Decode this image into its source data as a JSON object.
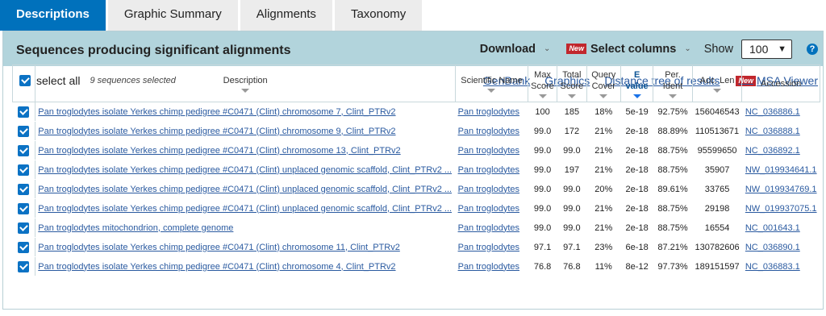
{
  "tabs": [
    {
      "label": "Descriptions",
      "active": true
    },
    {
      "label": "Graphic Summary",
      "active": false
    },
    {
      "label": "Alignments",
      "active": false
    },
    {
      "label": "Taxonomy",
      "active": false
    }
  ],
  "panel": {
    "title": "Sequences producing significant alignments",
    "download_label": "Download",
    "new_badge": "New",
    "select_columns_label": "Select columns",
    "show_label": "Show",
    "show_value": "100",
    "help_glyph": "?"
  },
  "toolbar": {
    "select_all_label": "select all",
    "selected_count": "9 sequences selected",
    "links": {
      "genbank": "GenBank",
      "graphics": "Graphics",
      "distance_tree": "Distance tree of results",
      "msa_viewer": "MSA Viewer"
    },
    "msa_badge": "New"
  },
  "table": {
    "headers": {
      "description": "Description",
      "scientific_name": "Scientific Name",
      "max_score": [
        "Max",
        "Score"
      ],
      "total_score": [
        "Total",
        "Score"
      ],
      "query_cover": [
        "Query",
        "Cover"
      ],
      "e_value": [
        "E",
        "value"
      ],
      "per_ident": [
        "Per.",
        "Ident"
      ],
      "acc_len": "Acc. Len",
      "accession": "Accession"
    },
    "rows": [
      {
        "checked": true,
        "description": "Pan troglodytes isolate Yerkes chimp pedigree #C0471 (Clint) chromosome 7, Clint_PTRv2",
        "scientific_name": "Pan troglodytes",
        "max_score": "100",
        "total_score": "185",
        "query_cover": "18%",
        "e_value": "5e-19",
        "per_ident": "92.75%",
        "acc_len": "156046543",
        "accession": "NC_036886.1"
      },
      {
        "checked": true,
        "description": "Pan troglodytes isolate Yerkes chimp pedigree #C0471 (Clint) chromosome 9, Clint_PTRv2",
        "scientific_name": "Pan troglodytes",
        "max_score": "99.0",
        "total_score": "172",
        "query_cover": "21%",
        "e_value": "2e-18",
        "per_ident": "88.89%",
        "acc_len": "110513671",
        "accession": "NC_036888.1"
      },
      {
        "checked": true,
        "description": "Pan troglodytes isolate Yerkes chimp pedigree #C0471 (Clint) chromosome 13, Clint_PTRv2",
        "scientific_name": "Pan troglodytes",
        "max_score": "99.0",
        "total_score": "99.0",
        "query_cover": "21%",
        "e_value": "2e-18",
        "per_ident": "88.75%",
        "acc_len": "95599650",
        "accession": "NC_036892.1"
      },
      {
        "checked": true,
        "description": "Pan troglodytes isolate Yerkes chimp pedigree #C0471 (Clint) unplaced genomic scaffold, Clint_PTRv2 ...",
        "scientific_name": "Pan troglodytes",
        "max_score": "99.0",
        "total_score": "197",
        "query_cover": "21%",
        "e_value": "2e-18",
        "per_ident": "88.75%",
        "acc_len": "35907",
        "accession": "NW_019934641.1"
      },
      {
        "checked": true,
        "description": "Pan troglodytes isolate Yerkes chimp pedigree #C0471 (Clint) unplaced genomic scaffold, Clint_PTRv2 ...",
        "scientific_name": "Pan troglodytes",
        "max_score": "99.0",
        "total_score": "99.0",
        "query_cover": "20%",
        "e_value": "2e-18",
        "per_ident": "89.61%",
        "acc_len": "33765",
        "accession": "NW_019934769.1"
      },
      {
        "checked": true,
        "description": "Pan troglodytes isolate Yerkes chimp pedigree #C0471 (Clint) unplaced genomic scaffold, Clint_PTRv2 ...",
        "scientific_name": "Pan troglodytes",
        "max_score": "99.0",
        "total_score": "99.0",
        "query_cover": "21%",
        "e_value": "2e-18",
        "per_ident": "88.75%",
        "acc_len": "29198",
        "accession": "NW_019937075.1"
      },
      {
        "checked": true,
        "description": "Pan troglodytes mitochondrion, complete genome",
        "scientific_name": "Pan troglodytes",
        "max_score": "99.0",
        "total_score": "99.0",
        "query_cover": "21%",
        "e_value": "2e-18",
        "per_ident": "88.75%",
        "acc_len": "16554",
        "accession": "NC_001643.1"
      },
      {
        "checked": true,
        "description": "Pan troglodytes isolate Yerkes chimp pedigree #C0471 (Clint) chromosome 11, Clint_PTRv2",
        "scientific_name": "Pan troglodytes",
        "max_score": "97.1",
        "total_score": "97.1",
        "query_cover": "23%",
        "e_value": "6e-18",
        "per_ident": "87.21%",
        "acc_len": "130782606",
        "accession": "NC_036890.1"
      },
      {
        "checked": true,
        "description": "Pan troglodytes isolate Yerkes chimp pedigree #C0471 (Clint) chromosome 4, Clint_PTRv2",
        "scientific_name": "Pan troglodytes",
        "max_score": "76.8",
        "total_score": "76.8",
        "query_cover": "11%",
        "e_value": "8e-12",
        "per_ident": "97.73%",
        "acc_len": "189151597",
        "accession": "NC_036883.1"
      }
    ]
  },
  "colors": {
    "active_tab": "#0071bc",
    "panel_header": "#b2d4dc",
    "link": "#2a5aa0",
    "new_badge": "#c1272d",
    "checkbox": "#0b72c4"
  }
}
